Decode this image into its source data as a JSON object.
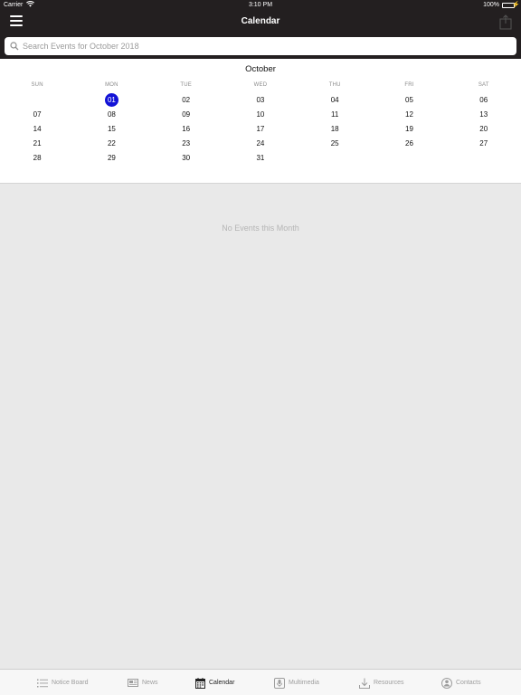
{
  "status_bar": {
    "carrier": "Carrier",
    "time": "3:10 PM",
    "battery": "100%"
  },
  "nav": {
    "title": "Calendar"
  },
  "search": {
    "placeholder": "Search Events for October 2018"
  },
  "calendar": {
    "month": "October",
    "weekdays": [
      "SUN",
      "MON",
      "TUE",
      "WED",
      "THU",
      "FRI",
      "SAT"
    ],
    "selected_day": "01",
    "weeks": [
      [
        "",
        "01",
        "02",
        "03",
        "04",
        "05",
        "06"
      ],
      [
        "07",
        "08",
        "09",
        "10",
        "11",
        "12",
        "13"
      ],
      [
        "14",
        "15",
        "16",
        "17",
        "18",
        "19",
        "20"
      ],
      [
        "21",
        "22",
        "23",
        "24",
        "25",
        "26",
        "27"
      ],
      [
        "28",
        "29",
        "30",
        "31",
        "",
        "",
        ""
      ]
    ]
  },
  "events": {
    "empty_message": "No Events this Month"
  },
  "tabs": [
    {
      "label": "Notice Board",
      "icon": "list-icon"
    },
    {
      "label": "News",
      "icon": "newspaper-icon"
    },
    {
      "label": "Calendar",
      "icon": "calendar-icon",
      "active": true
    },
    {
      "label": "Multimedia",
      "icon": "microphone-icon"
    },
    {
      "label": "Resources",
      "icon": "download-icon"
    },
    {
      "label": "Contacts",
      "icon": "contact-icon"
    }
  ],
  "colors": {
    "nav_background": "#231f20",
    "selected_day": "#1212d6",
    "battery": "#4cd964"
  }
}
